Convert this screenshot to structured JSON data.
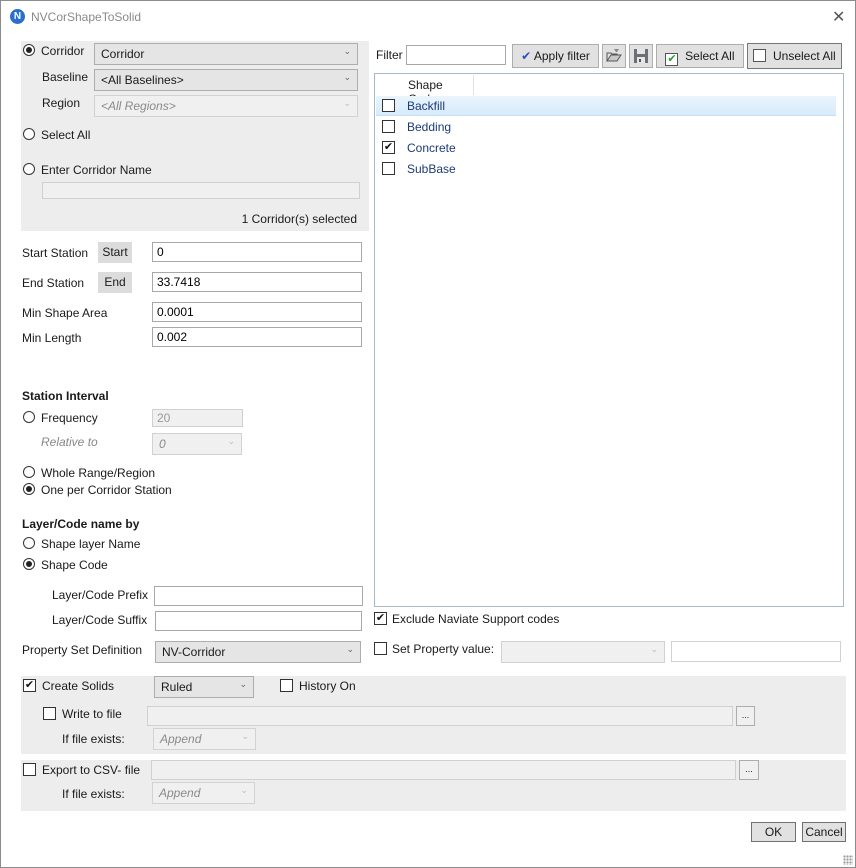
{
  "window": {
    "title": "NVCorShapeToSolid",
    "logo_letter": "N",
    "close_glyph": "✕"
  },
  "corridor": {
    "corridor_radio_label": "Corridor",
    "corridor_selected": true,
    "corridor_value": "Corridor",
    "baseline_label": "Baseline",
    "baseline_value": "<All Baselines>",
    "region_label": "Region",
    "region_value": "<All Regions>",
    "select_all_label": "Select All",
    "enter_name_label": "Enter Corridor Name",
    "enter_name_value": "",
    "status": "1 Corridor(s) selected"
  },
  "stations": {
    "start_label": "Start Station",
    "start_button": "Start",
    "start_value": "0",
    "end_label": "End Station",
    "end_button": "End",
    "end_value": "33.7418",
    "min_area_label": "Min Shape Area",
    "min_area_value": "0.0001",
    "min_length_label": "Min Length",
    "min_length_value": "0.002"
  },
  "interval": {
    "heading": "Station Interval",
    "frequency_label": "Frequency",
    "frequency_value": "20",
    "relative_label": "Relative to",
    "relative_value": "0",
    "whole_label": "Whole Range/Region",
    "one_per_label": "One per Corridor Station",
    "selected": "one_per"
  },
  "naming": {
    "heading": "Layer/Code name by",
    "layer_name_label": "Shape layer Name",
    "shape_code_label": "Shape Code",
    "selected": "shape_code",
    "prefix_label": "Layer/Code Prefix",
    "prefix_value": "",
    "suffix_label": "Layer/Code Suffix",
    "suffix_value": ""
  },
  "property_set": {
    "label": "Property Set Definition",
    "value": "NV-Corridor"
  },
  "filter": {
    "label": "Filter",
    "value": "",
    "apply_label": "Apply filter",
    "apply_icon": "✔",
    "select_all_label": "Select All",
    "unselect_all_label": "Unselect All"
  },
  "shape_codes": {
    "column_header": "Shape Code",
    "items": [
      {
        "name": "Backfill",
        "checked": false,
        "highlighted": true
      },
      {
        "name": "Bedding",
        "checked": false
      },
      {
        "name": "Concrete",
        "checked": true
      },
      {
        "name": "SubBase",
        "checked": false
      }
    ]
  },
  "exclude_support": {
    "label": "Exclude Naviate Support codes",
    "checked": true
  },
  "set_property": {
    "label": "Set Property value:",
    "checked": false,
    "combo_value": "",
    "text_value": ""
  },
  "solids": {
    "create_label": "Create Solids",
    "create_checked": true,
    "method": "Ruled",
    "history_label": "History On",
    "history_checked": false,
    "write_label": "Write to file",
    "write_checked": false,
    "write_path": "",
    "browse": "...",
    "exists_label": "If file exists:",
    "exists_value": "Append"
  },
  "csv": {
    "label": "Export to CSV- file",
    "checked": false,
    "path": "",
    "browse": "...",
    "exists_label": "If file exists:",
    "exists_value": "Append"
  },
  "footer": {
    "ok": "OK",
    "cancel": "Cancel"
  }
}
